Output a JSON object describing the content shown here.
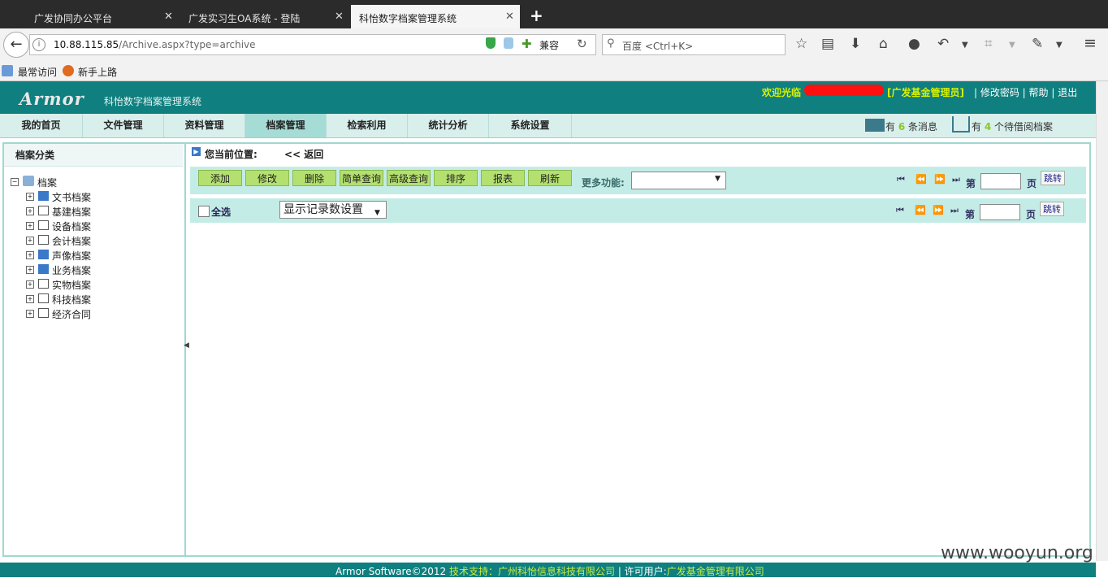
{
  "browser": {
    "tabs": [
      {
        "title": "广发协同办公平台",
        "active": false
      },
      {
        "title": "广发实习生OA系统 - 登陆",
        "active": false
      },
      {
        "title": "科怡数字档案管理系统",
        "active": true
      }
    ],
    "url_host": "10.88.115.85",
    "url_path": "/Archive.aspx?type=archive",
    "compat_label": "兼容",
    "search_placeholder": "百度 <Ctrl+K>",
    "bookmarks": [
      "最常访问",
      "新手上路"
    ]
  },
  "app": {
    "logo": "Armor",
    "name": "科怡数字档案管理系统",
    "welcome": "欢迎光临",
    "user_role": "[广发基金管理员]",
    "links": "| 修改密码 | 帮助 | 退出",
    "menu": [
      "我的首页",
      "文件管理",
      "资料管理",
      "档案管理",
      "检索利用",
      "统计分析",
      "系统设置"
    ],
    "active_menu": "档案管理",
    "messages": {
      "prefix": "有",
      "count": "6",
      "suffix": "条消息"
    },
    "borrow": {
      "prefix": "有",
      "count": "4",
      "suffix": "个待借阅档案"
    }
  },
  "left": {
    "title": "档案分类",
    "root": "档案",
    "items": [
      "文书档案",
      "基建档案",
      "设备档案",
      "会计档案",
      "声像档案",
      "业务档案",
      "实物档案",
      "科技档案",
      "经济合同"
    ]
  },
  "main": {
    "breadcrumb": "您当前位置:",
    "back": "<< 返回",
    "buttons": [
      "添加",
      "修改",
      "删除",
      "简单查询",
      "高级查询",
      "排序",
      "报表",
      "刷新"
    ],
    "more_label": "更多功能:",
    "page_prefix": "第",
    "page_suffix": "页",
    "jump": "跳转",
    "select_all": "全选",
    "display_setting": "显示记录数设置"
  },
  "footer": {
    "brand": "Armor Software©2012",
    "support": "技术支持：广州科怡信息科技有限公司",
    "license_label": "| 许可用户:",
    "license": "广发基金管理有限公司"
  },
  "watermark": "www.wooyun.org"
}
